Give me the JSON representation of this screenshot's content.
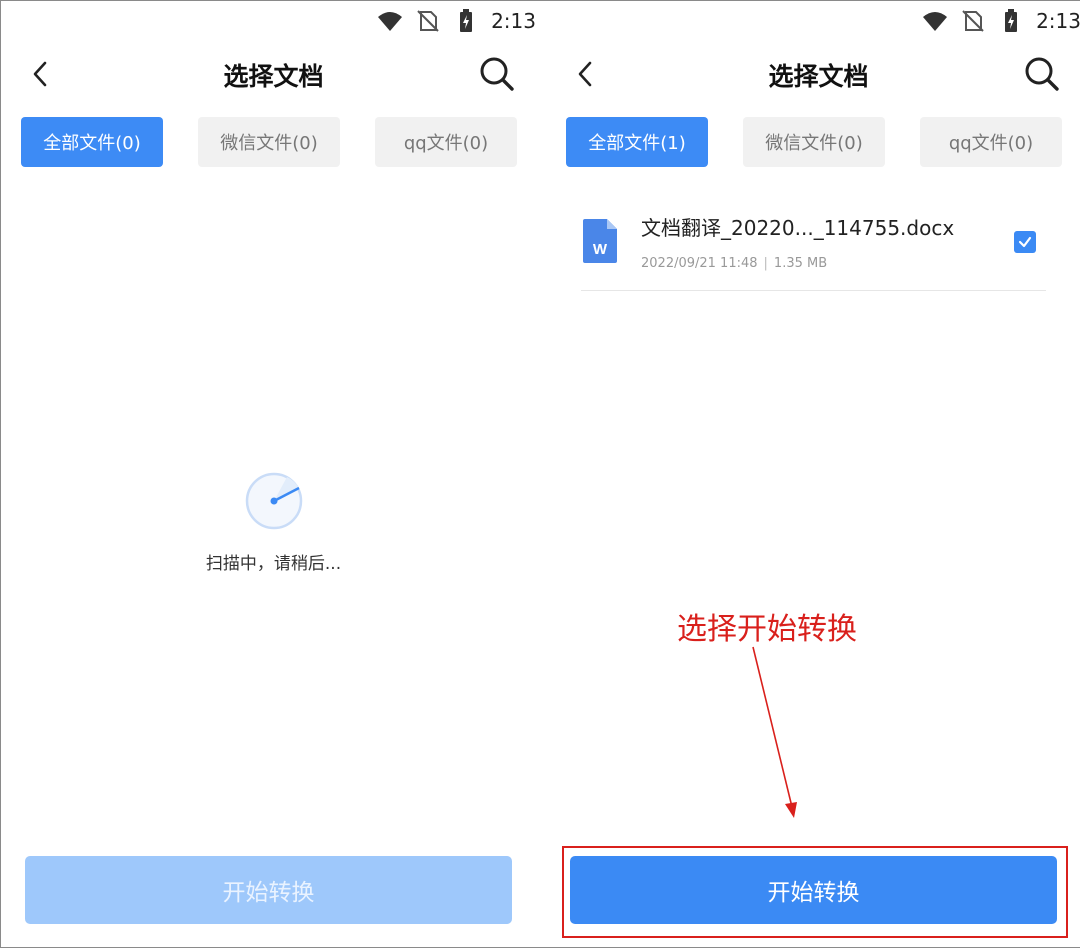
{
  "statusbar": {
    "time": "2:13"
  },
  "left": {
    "title": "选择文档",
    "tabs": [
      {
        "label": "全部文件(0)",
        "active": true
      },
      {
        "label": "微信文件(0)",
        "active": false
      },
      {
        "label": "qq文件(0)",
        "active": false
      }
    ],
    "scan_text": "扫描中，请稍后...",
    "start_button": "开始转换"
  },
  "right": {
    "title": "选择文档",
    "tabs": [
      {
        "label": "全部文件(1)",
        "active": true
      },
      {
        "label": "微信文件(0)",
        "active": false
      },
      {
        "label": "qq文件(0)",
        "active": false
      }
    ],
    "files": [
      {
        "name": "文档翻译_20220..._114755.docx",
        "date": "2022/09/21 11:48",
        "separator": "|",
        "size": "1.35 MB",
        "icon_letter": "W",
        "checked": true
      }
    ],
    "start_button": "开始转换"
  },
  "annotation": {
    "text": "选择开始转换",
    "color": "#d9201c"
  },
  "colors": {
    "accent": "#3b8af4",
    "disabled_button": "#9ec8fb",
    "tab_inactive_bg": "#f1f1f1"
  },
  "icons": [
    "wifi-icon",
    "no-sim-icon",
    "battery-charging-icon",
    "back-arrow-icon",
    "search-icon",
    "scan-radar-icon",
    "word-doc-icon",
    "checkmark-icon"
  ]
}
